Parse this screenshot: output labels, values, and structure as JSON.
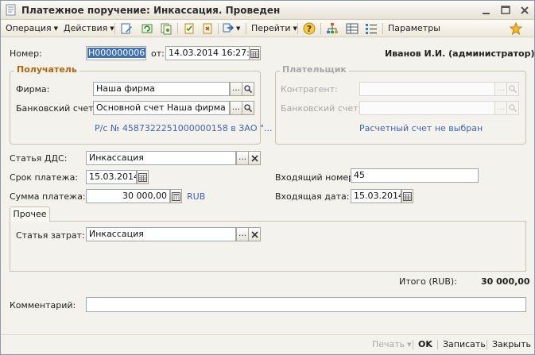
{
  "window": {
    "title": "Платежное поручение: Инкассация. Проведен"
  },
  "toolbar": {
    "operation": "Операция",
    "actions": "Действия",
    "goto": "Перейти",
    "parameters": "Параметры"
  },
  "header": {
    "number_label": "Номер:",
    "number_value": "Н000000006",
    "from_label": "от:",
    "date_value": "14.03.2014 16:27:26",
    "user": "Иванов И.И. (администратор)"
  },
  "recipient": {
    "title": "Получатель",
    "firm_label": "Фирма:",
    "firm_value": "Наша фирма",
    "account_label": "Банковский счет:",
    "account_value": "Основной счет Наша фирма",
    "account_link": "Р/с № 45873222510000001​58 в ЗАО \"..."
  },
  "payer": {
    "title": "Плательщик",
    "counterparty_label": "Контрагент:",
    "counterparty_value": "",
    "account_label": "Банковский счет:",
    "account_value": "",
    "account_link": "Расчетный счет не выбран"
  },
  "details": {
    "dds_label": "Статья ДДС:",
    "dds_value": "Инкассация",
    "due_label": "Срок платежа:",
    "due_value": "15.03.2014",
    "amount_label": "Сумма платежа:",
    "amount_value": "30 000,00",
    "currency": "RUB",
    "incoming_number_label": "Входящий номер:",
    "incoming_number_value": "45",
    "incoming_date_label": "Входящая дата:",
    "incoming_date_value": "15.03.2014"
  },
  "tabs": {
    "other_label": "Прочее",
    "cost_item_label": "Статья затрат:",
    "cost_item_value": "Инкассация"
  },
  "totals": {
    "total_label": "Итого (RUB):",
    "total_value": "30 000,00"
  },
  "comment": {
    "label": "Комментарий:",
    "value": ""
  },
  "footer": {
    "print": "Печать",
    "ok": "OK",
    "save": "Записать",
    "close": "Закрыть"
  }
}
